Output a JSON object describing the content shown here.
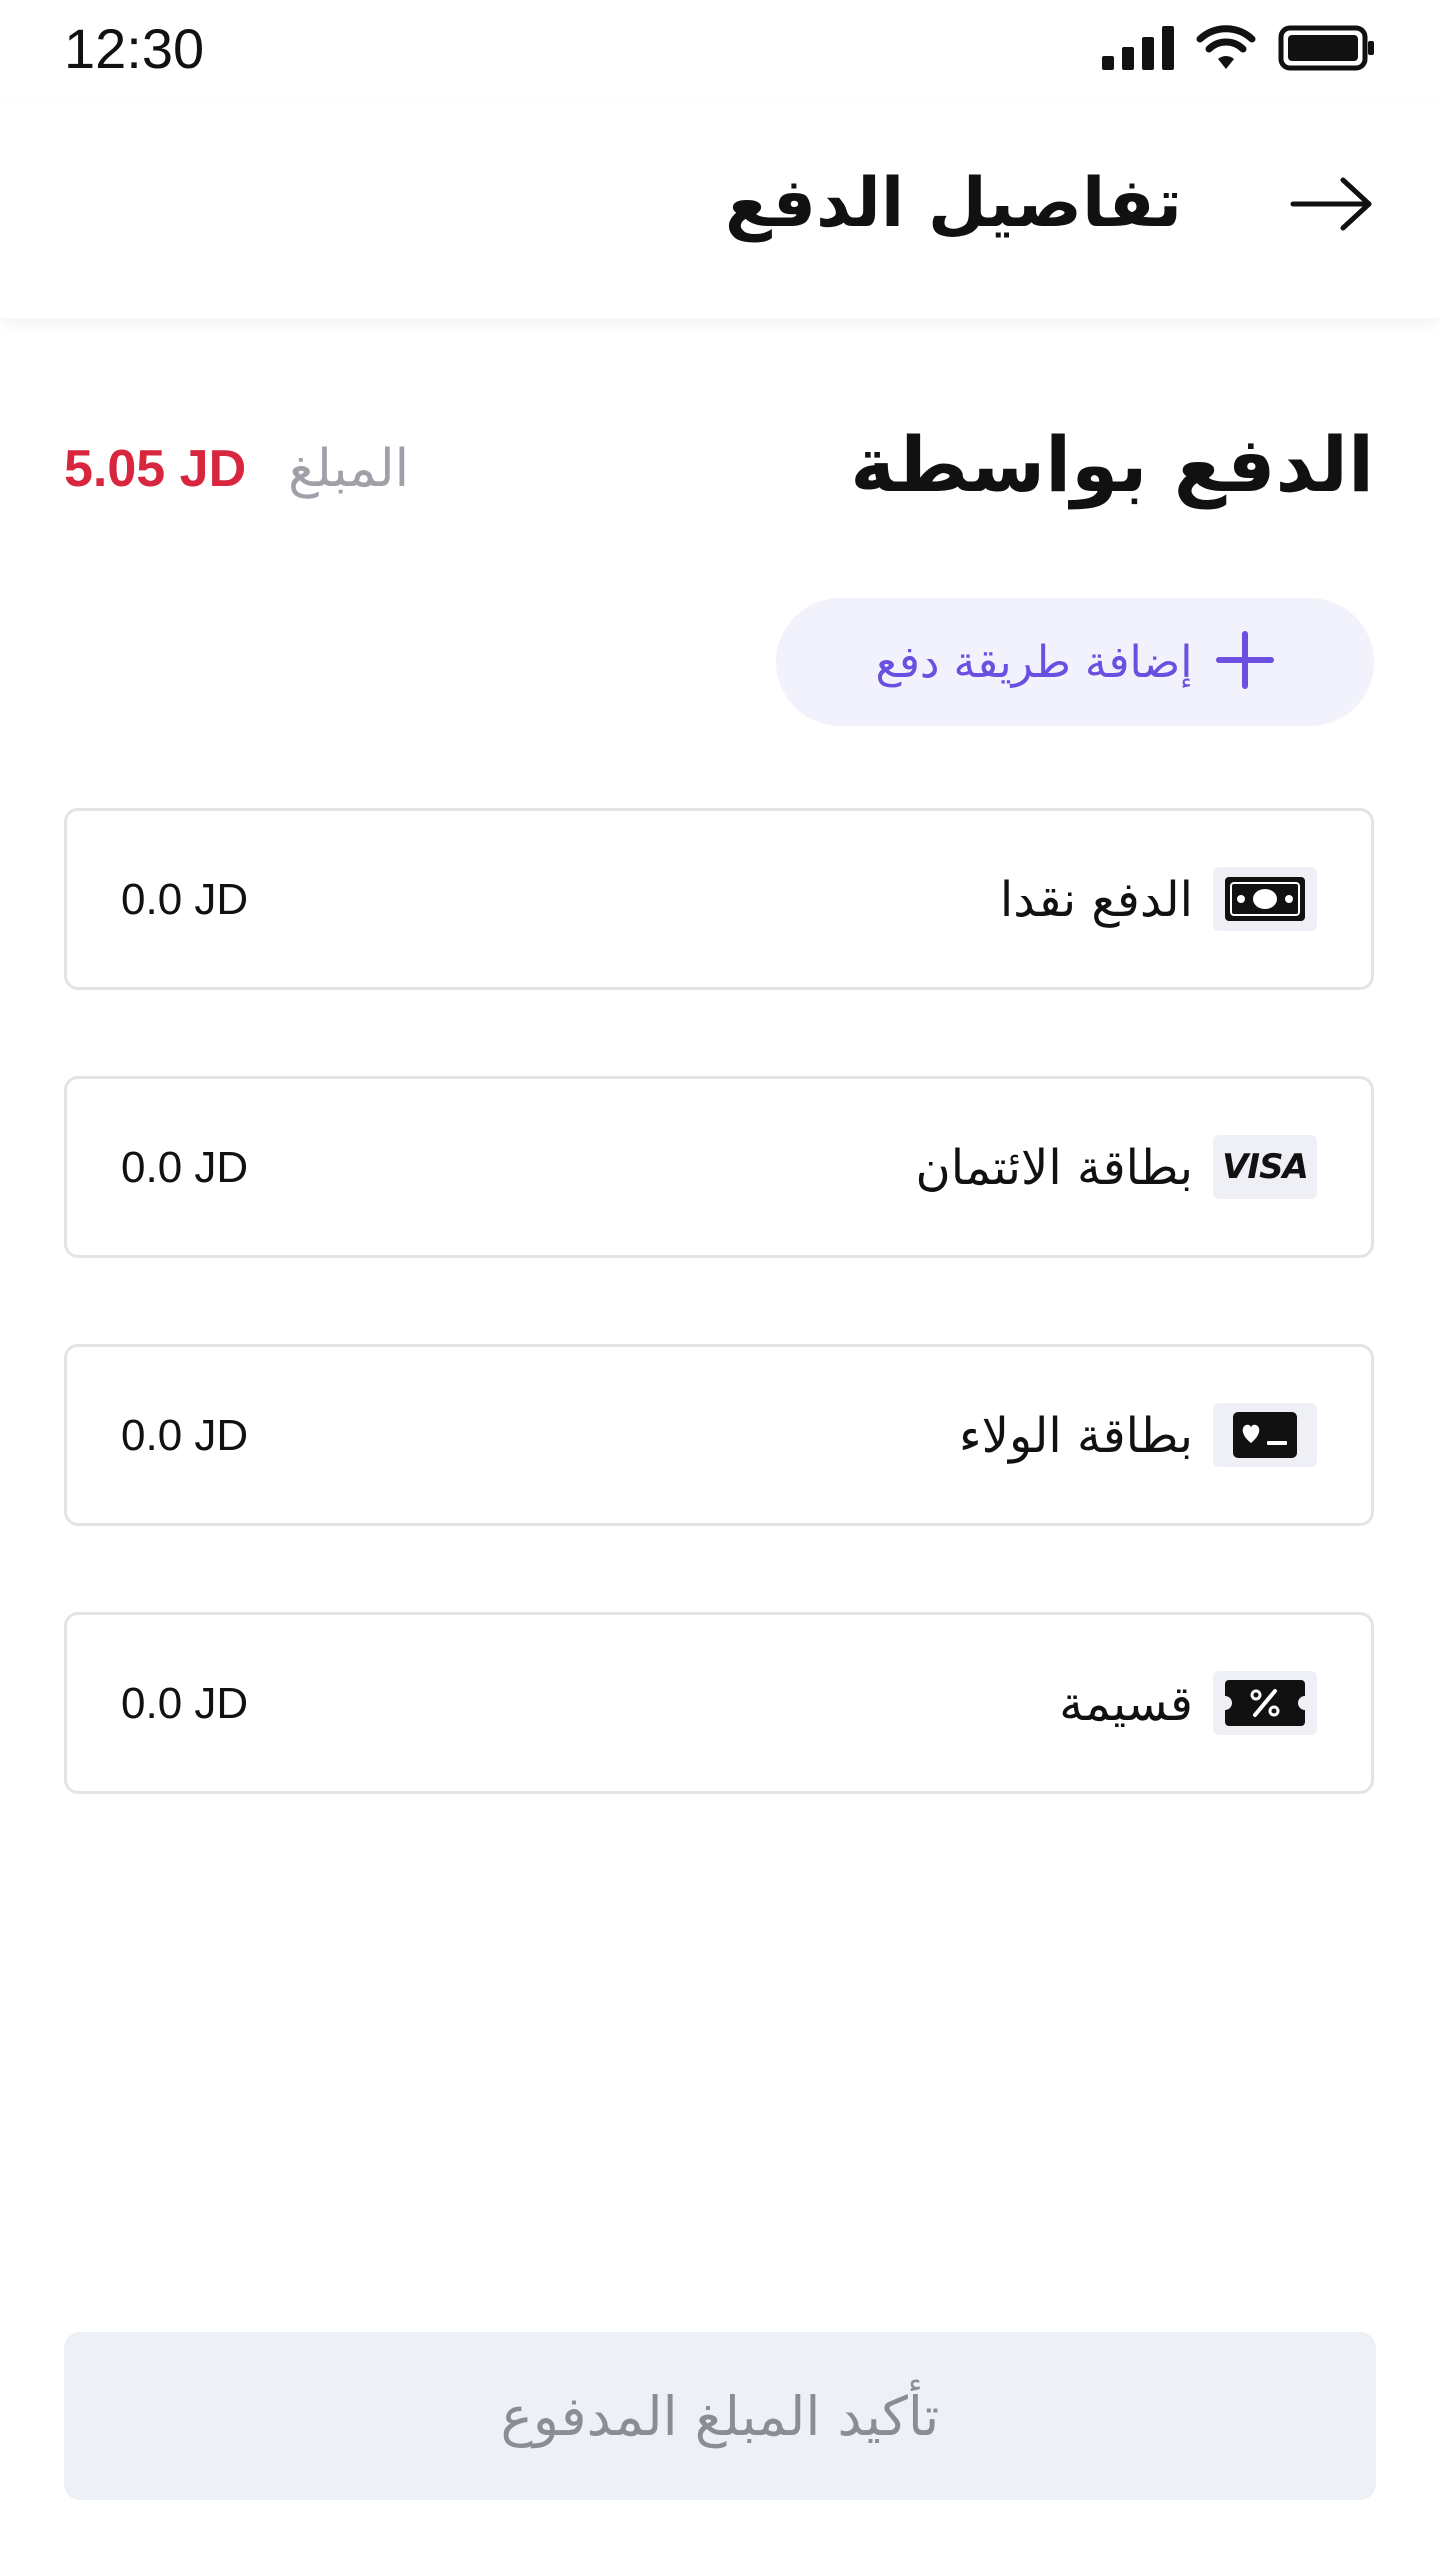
{
  "status_bar": {
    "time": "12:30",
    "icons": [
      "signal-icon",
      "wifi-icon",
      "battery-icon"
    ]
  },
  "header": {
    "title": "تفاصيل الدفع",
    "back_icon": "arrow-right-icon"
  },
  "summary": {
    "pay_with_title": "الدفع بواسطة",
    "amount_label": "المبلغ",
    "amount_value": "5.05 JD"
  },
  "add_method": {
    "label": "إضافة طريقة دفع",
    "icon": "plus-icon"
  },
  "methods": [
    {
      "label": "الدفع نقدا",
      "amount": "0.0 JD",
      "icon": "cash-icon"
    },
    {
      "label": "بطاقة الائتمان",
      "amount": "0.0 JD",
      "icon": "visa-icon",
      "icon_text": "VISA"
    },
    {
      "label": "بطاقة الولاء",
      "amount": "0.0 JD",
      "icon": "loyalty-card-icon"
    },
    {
      "label": "قسيمة",
      "amount": "0.0 JD",
      "icon": "voucher-icon"
    }
  ],
  "confirm": {
    "label": "تأكيد المبلغ المدفوع"
  },
  "colors": {
    "accent": "#6b4fe0",
    "amount": "#d7263d",
    "muted": "#a0a0a8",
    "card_border": "#e3e3e8",
    "button_disabled_bg": "#eef0f8"
  }
}
